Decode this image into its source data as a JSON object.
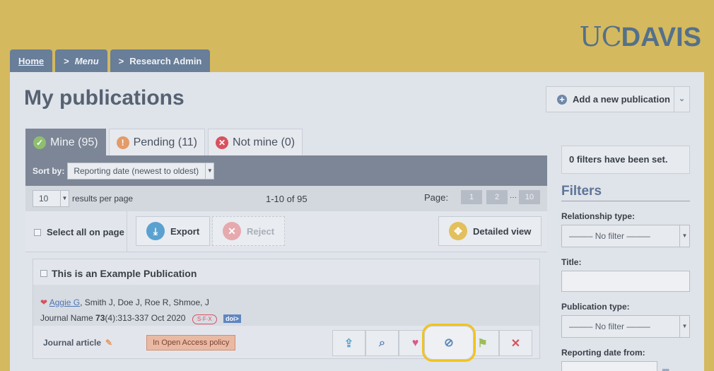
{
  "brand": {
    "logo_light": "UC",
    "logo_bold": "DAVIS"
  },
  "breadcrumb": {
    "home": "Home",
    "menu": "Menu",
    "current": "Research Admin",
    "chevron": ">"
  },
  "page": {
    "title": "My publications",
    "add_button": "Add a new publication"
  },
  "tabs": [
    {
      "label": "Mine (95)",
      "icon": "✓"
    },
    {
      "label": "Pending (11)",
      "icon": "!"
    },
    {
      "label": "Not mine (0)",
      "icon": "✕"
    }
  ],
  "sort": {
    "label": "Sort by:",
    "value": "Reporting date (newest to oldest)"
  },
  "pagination": {
    "per_page": "10",
    "per_page_label": "results per page",
    "range": "1-10 of 95",
    "page_label": "Page:",
    "pages": [
      "1",
      "2",
      "10"
    ],
    "ellipsis": "···"
  },
  "actions": {
    "select_all": "Select all on page",
    "export": "Export",
    "reject": "Reject",
    "detailed_view": "Detailed view"
  },
  "publication": {
    "title": "This is an Example Publication",
    "author_link": "Aggie G",
    "authors_rest": ", Smith J, Doe J, Roe R, Shmoe, J",
    "journal": "Journal Name",
    "volume": "73",
    "issue_pages": "(4):313-337 Oct 2020",
    "sfx_label": "S·F·X",
    "doi_label": "doi>",
    "type": "Journal article",
    "oa_badge": "In Open Access policy"
  },
  "icon_buttons": [
    "upload-file-icon",
    "search-icon",
    "heart-icon",
    "eye-slash-icon",
    "hide-icon",
    "close-icon"
  ],
  "sidebar": {
    "filter_count": "0 filters have been set.",
    "filters_heading": "Filters",
    "relationship_label": "Relationship type:",
    "no_filter": "––––– No filter –––––",
    "title_label": "Title:",
    "pubtype_label": "Publication type:",
    "reporting_from_label": "Reporting date from:"
  },
  "colors": {
    "gold": "#d4b95e",
    "slate": "#7c8696",
    "highlight": "#f2c31d"
  }
}
